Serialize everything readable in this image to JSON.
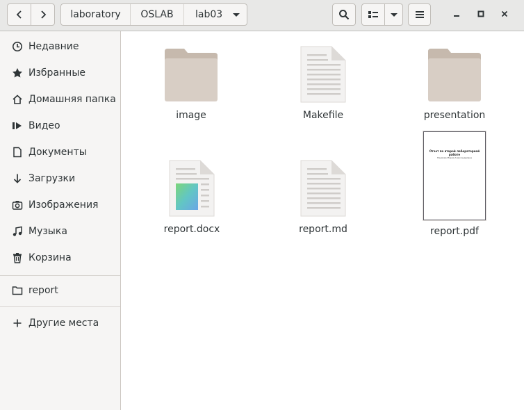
{
  "header": {
    "breadcrumbs": [
      "laboratory",
      "OSLAB",
      "lab03"
    ],
    "buttons": {
      "back": "chevron-left-icon",
      "forward": "chevron-right-icon",
      "search": "search-icon",
      "view": "list-view-icon",
      "view_options": "chevron-down-icon",
      "menu": "hamburger-menu-icon"
    },
    "window_controls": [
      "minimize-icon",
      "maximize-icon",
      "close-icon"
    ]
  },
  "sidebar": {
    "items": [
      {
        "label": "Недавние",
        "icon": "clock-icon"
      },
      {
        "label": "Избранные",
        "icon": "star-icon"
      },
      {
        "label": "Домашняя папка",
        "icon": "home-icon"
      },
      {
        "label": "Видео",
        "icon": "video-icon"
      },
      {
        "label": "Документы",
        "icon": "document-icon"
      },
      {
        "label": "Загрузки",
        "icon": "download-icon"
      },
      {
        "label": "Изображения",
        "icon": "camera-icon"
      },
      {
        "label": "Музыка",
        "icon": "music-icon"
      },
      {
        "label": "Корзина",
        "icon": "trash-icon"
      }
    ],
    "bookmarks": [
      {
        "label": "report",
        "icon": "folder-icon"
      }
    ],
    "other_locations": {
      "label": "Другие места",
      "icon": "plus-icon"
    }
  },
  "files": [
    {
      "name": "image",
      "type": "folder"
    },
    {
      "name": "Makefile",
      "type": "text"
    },
    {
      "name": "presentation",
      "type": "folder"
    },
    {
      "name": "report.docx",
      "type": "docx"
    },
    {
      "name": "report.md",
      "type": "text"
    },
    {
      "name": "report.pdf",
      "type": "pdf",
      "preview_title": "Отчет по второй лабораторной работе",
      "preview_subtitle": "Наумова Мария Александровна"
    }
  ],
  "colors": {
    "folder": "#d8cec5",
    "folder_tab": "#c6b9ad",
    "sidebar_bg": "#f6f5f4",
    "header_bg": "#e8e8e7"
  }
}
